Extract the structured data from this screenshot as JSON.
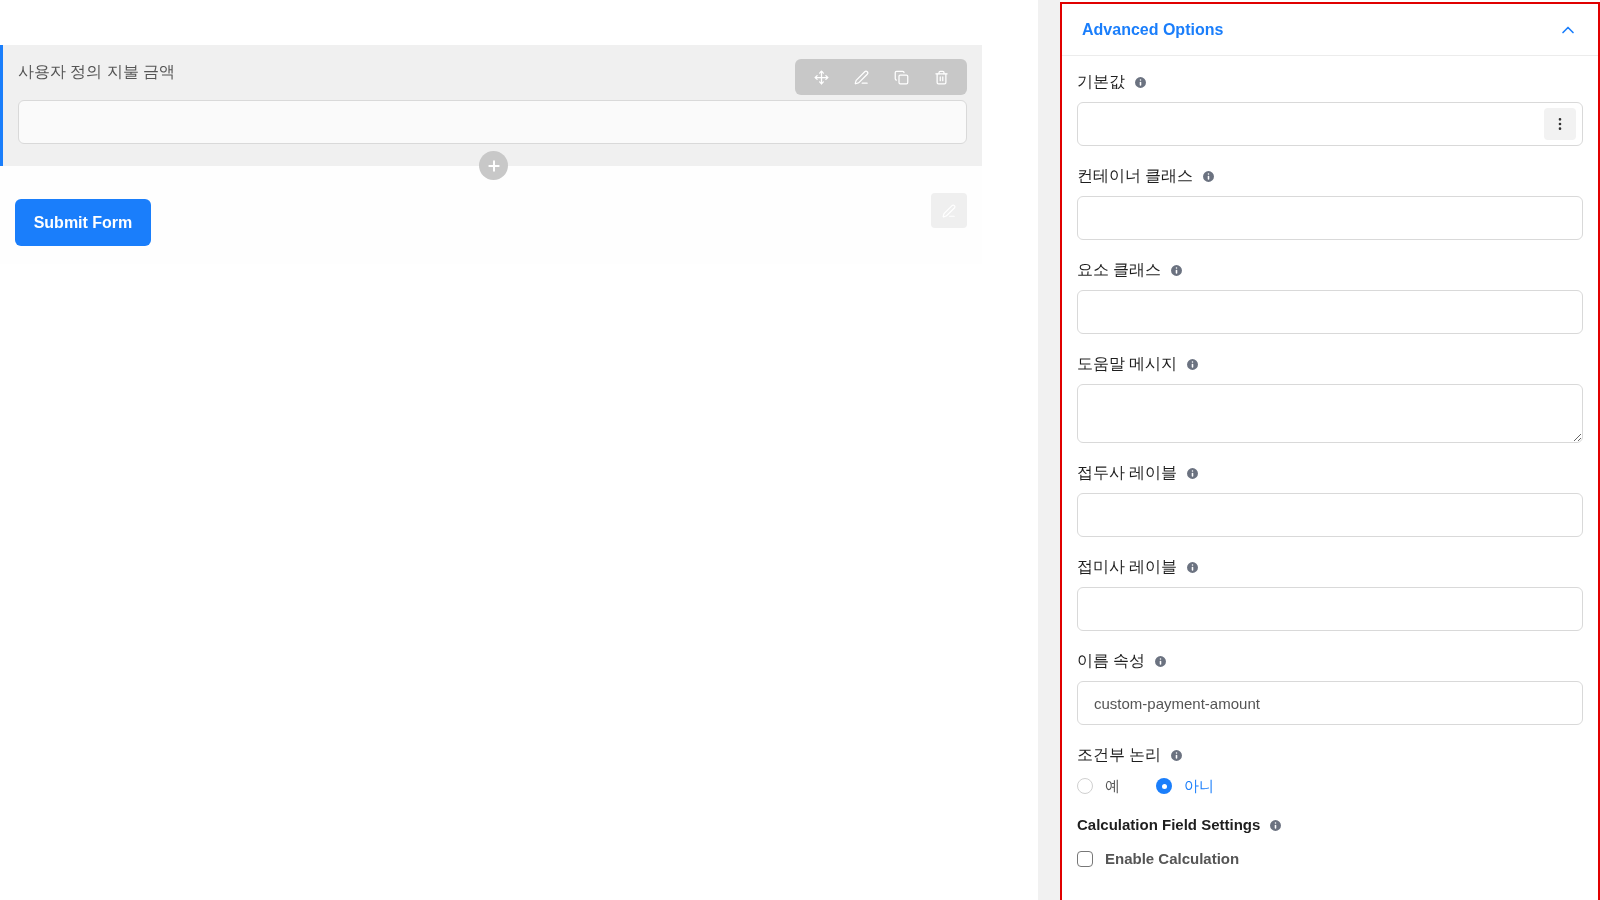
{
  "form": {
    "field_label": "사용자 정의 지불 금액",
    "submit": "Submit Form"
  },
  "panel": {
    "title": "Advanced Options",
    "expanded": true,
    "fields": [
      {
        "kind": "input_menu",
        "label": "기본값"
      },
      {
        "kind": "input",
        "label": "컨테이너 클래스"
      },
      {
        "kind": "input",
        "label": "요소 클래스"
      },
      {
        "kind": "textarea",
        "label": "도움말 메시지"
      },
      {
        "kind": "input",
        "label": "접두사 레이블"
      },
      {
        "kind": "input",
        "label": "접미사 레이블"
      },
      {
        "kind": "input",
        "label": "이름 속성",
        "value": "custom-payment-amount"
      },
      {
        "kind": "radio",
        "label": "조건부 논리",
        "options": [
          {
            "label": "예",
            "selected": false
          },
          {
            "label": "아니",
            "selected": true
          }
        ]
      }
    ],
    "calculation": {
      "title": "Calculation Field Settings",
      "checkbox": {
        "label": "Enable Calculation",
        "checked": false
      }
    }
  }
}
